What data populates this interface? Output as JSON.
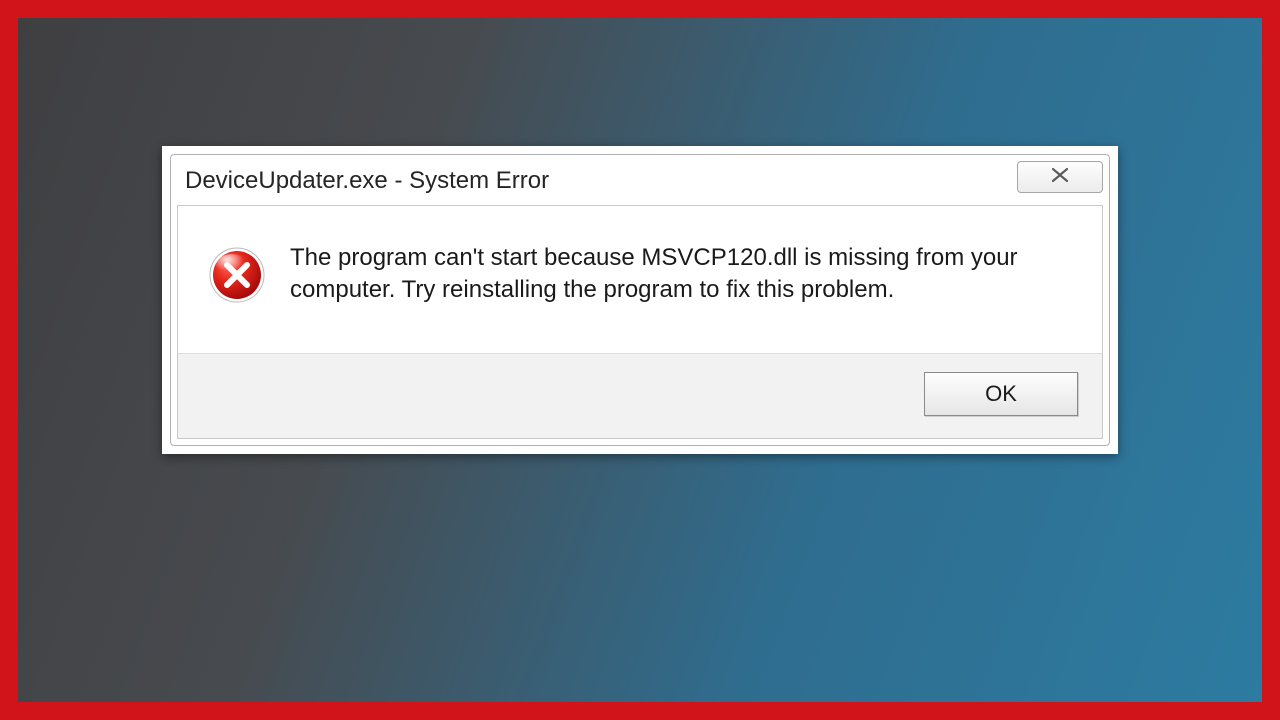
{
  "dialog": {
    "title": "DeviceUpdater.exe - System Error",
    "close_glyph": "✕",
    "message": "The program can't start because MSVCP120.dll is missing from your computer. Try reinstalling the program to fix this problem.",
    "ok_label": "OK"
  }
}
